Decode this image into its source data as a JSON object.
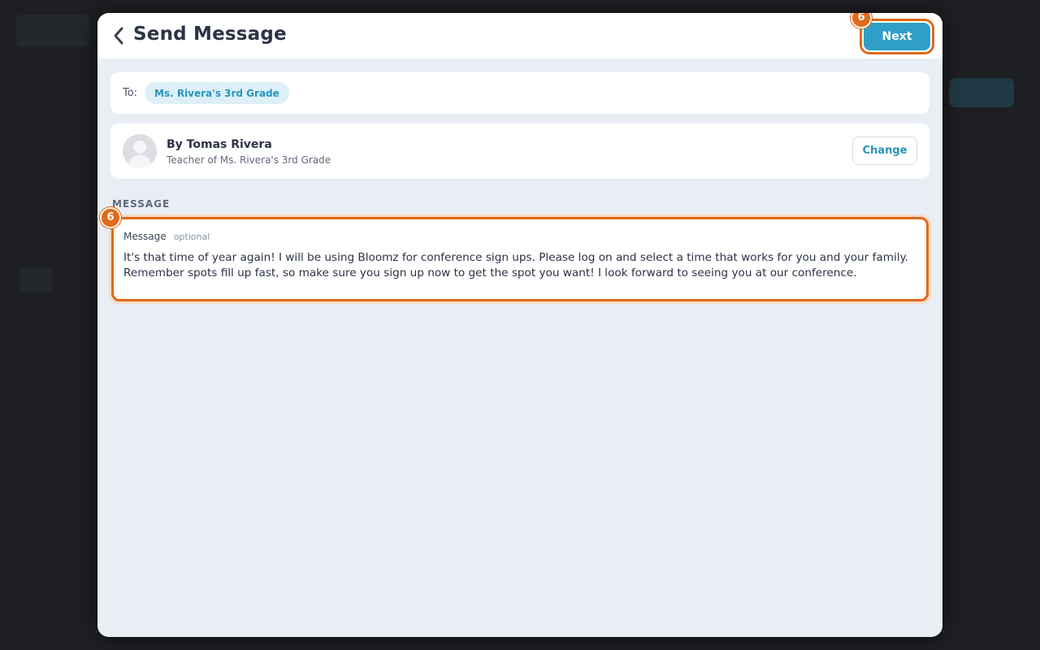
{
  "header": {
    "title": "Send Message",
    "next_label": "Next",
    "step_badge": "6"
  },
  "to": {
    "label": "To:",
    "recipient": "Ms. Rivera's 3rd Grade"
  },
  "sender": {
    "name": "By Tomas Rivera",
    "role": "Teacher of Ms. Rivera's 3rd Grade",
    "change_label": "Change"
  },
  "message": {
    "section_label": "MESSAGE",
    "field_label": "Message",
    "optional_label": "optional",
    "step_badge": "6",
    "text": "It's that time of year again! I will be using Bloomz for conference sign ups. Please log on and select a time that works for you and your family. Remember spots fill up fast, so make sure you sign up now to get the spot you want! I look forward to seeing you at our conference."
  },
  "colors": {
    "accent": "#2f9fc9",
    "highlight": "#e06a1a",
    "panel": "#e9edf4"
  }
}
